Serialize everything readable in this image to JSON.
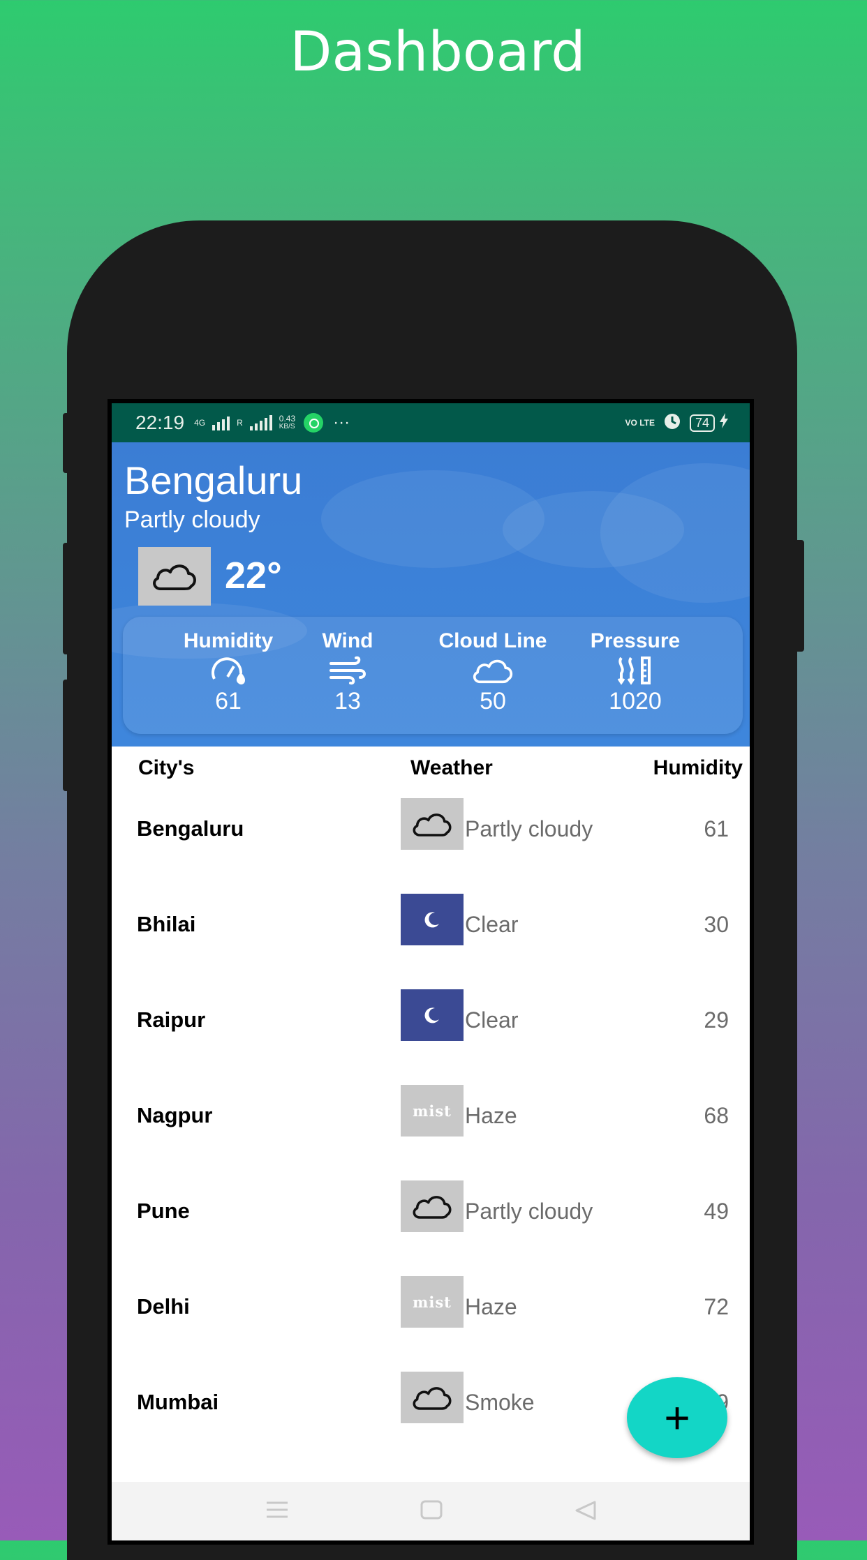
{
  "headline": "Dashboard",
  "status_bar": {
    "time": "22:19",
    "net_type": "4G",
    "roaming": "R",
    "speed_value": "0.43",
    "speed_unit": "KB/S",
    "more": "···",
    "volte": "VO LTE",
    "battery": "74"
  },
  "current": {
    "city": "Bengaluru",
    "condition": "Partly cloudy",
    "temperature": "22°",
    "icon": "cloud-icon",
    "stats": [
      {
        "label": "Humidity",
        "icon": "humidity-icon",
        "value": "61"
      },
      {
        "label": "Wind",
        "icon": "wind-icon",
        "value": "13"
      },
      {
        "label": "Cloud Line",
        "icon": "cloud-icon",
        "value": "50"
      },
      {
        "label": "Pressure",
        "icon": "pressure-icon",
        "value": "1020"
      }
    ]
  },
  "table": {
    "headers": {
      "city": "City's",
      "weather": "Weather",
      "humidity": "Humidity"
    },
    "rows": [
      {
        "city": "Bengaluru",
        "icon": "cloud-icon",
        "condition": "Partly cloudy",
        "humidity": "61"
      },
      {
        "city": "Bhilai",
        "icon": "moon-icon",
        "condition": "Clear",
        "humidity": "30"
      },
      {
        "city": "Raipur",
        "icon": "moon-icon",
        "condition": "Clear",
        "humidity": "29"
      },
      {
        "city": "Nagpur",
        "icon": "mist-icon",
        "icon_text": "mist",
        "condition": "Haze",
        "humidity": "68"
      },
      {
        "city": "Pune",
        "icon": "cloud-icon",
        "condition": "Partly cloudy",
        "humidity": "49"
      },
      {
        "city": "Delhi",
        "icon": "mist-icon",
        "icon_text": "mist",
        "condition": "Haze",
        "humidity": "72"
      },
      {
        "city": "Mumbai",
        "icon": "cloud-icon",
        "condition": "Smoke",
        "humidity": "9"
      }
    ]
  },
  "fab": {
    "label": "+"
  },
  "colors": {
    "gradient_top": "#2ecb6f",
    "gradient_bottom": "#985bb8",
    "header_blue": "#3e86dc",
    "status_bar": "#02594a",
    "clear_icon_bg": "#3b4a94",
    "cloud_icon_bg": "#c8c8c8",
    "fab": "#13d6c6"
  }
}
